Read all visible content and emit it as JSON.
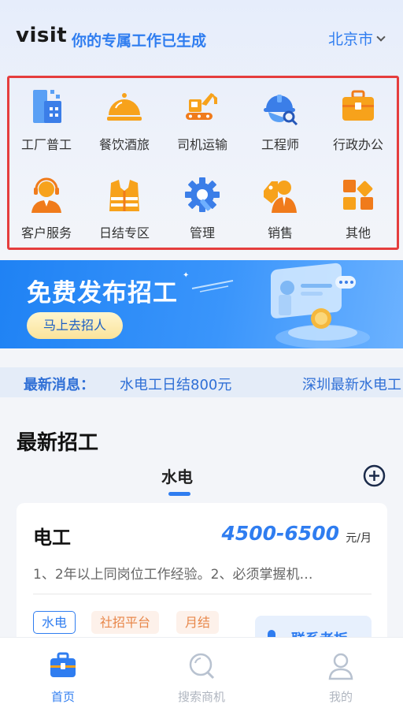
{
  "header": {
    "brand": "visit",
    "tagline": "你的专属工作已生成",
    "city": "北京市"
  },
  "categories": [
    {
      "label": "工厂普工",
      "icon": "factory-icon"
    },
    {
      "label": "餐饮酒旅",
      "icon": "food-cloche-icon"
    },
    {
      "label": "司机运输",
      "icon": "excavator-icon"
    },
    {
      "label": "工程师",
      "icon": "hard-hat-icon"
    },
    {
      "label": "行政办公",
      "icon": "briefcase-icon"
    },
    {
      "label": "客户服务",
      "icon": "headset-agent-icon"
    },
    {
      "label": "日结专区",
      "icon": "safety-vest-icon"
    },
    {
      "label": "管理",
      "icon": "gear-wrench-icon"
    },
    {
      "label": "销售",
      "icon": "salesperson-icon"
    },
    {
      "label": "其他",
      "icon": "grid-shapes-icon"
    }
  ],
  "banner": {
    "title": "免费发布招工",
    "button": "马上去招人"
  },
  "news": {
    "label": "最新消息：",
    "items": [
      "水电工日结800元",
      "深圳最新水电工"
    ]
  },
  "section": {
    "title": "最新招工",
    "active_tab": "水电"
  },
  "job": {
    "title": "电工",
    "salary": "4500-6500",
    "unit": "元/月",
    "description": "1、2年以上同岗位工作经验。2、必须掌握机…",
    "tags": [
      "水电",
      "社招平台",
      "月结"
    ],
    "contact": "联系老板"
  },
  "nav": [
    {
      "label": "首页",
      "icon": "home-briefcase-icon",
      "active": true
    },
    {
      "label": "搜索商机",
      "icon": "search-icon",
      "active": false
    },
    {
      "label": "我的",
      "icon": "profile-icon",
      "active": false
    }
  ],
  "colors": {
    "accent": "#2f7df0",
    "highlight_border": "#e53d3d",
    "icon_orange": "#f7a21b",
    "tag_orange": "#e8874a"
  }
}
